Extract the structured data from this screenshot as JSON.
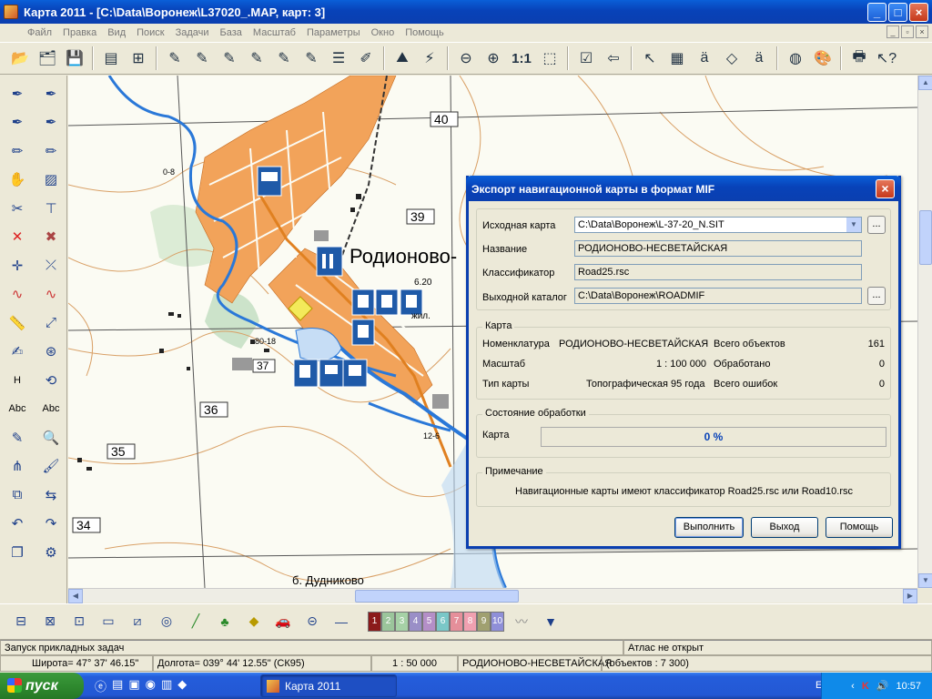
{
  "window": {
    "title": "Карта 2011 - [C:\\Data\\Воронеж\\L37020_.MAP, карт: 3]"
  },
  "menu": [
    "Файл",
    "Правка",
    "Вид",
    "Поиск",
    "Задачи",
    "База",
    "Масштаб",
    "Параметры",
    "Окно",
    "Помощь"
  ],
  "toolbar": {
    "scale_label": "1:1"
  },
  "lefttools": {
    "h_label": "H",
    "abc1": "Abc",
    "abc2": "Abc"
  },
  "map": {
    "place_main": "Родионово-",
    "place_south": "б. Дудниково",
    "place_zhil": "жил.",
    "grid_labels": [
      "40",
      "39",
      "37",
      "36",
      "35",
      "34"
    ],
    "small_labels": [
      "0-8",
      "6.20",
      "80-18",
      "12-6"
    ],
    "colors": {
      "urban": "#f2a35a",
      "water": "#2a78d8",
      "road": "#e08020",
      "contour": "#d9a066",
      "poi": "#1f5aa8",
      "vegetation": "#b8d9b8"
    }
  },
  "dialog": {
    "title": "Экспорт навигационной карты в формат MIF",
    "source_label": "Исходная карта",
    "source_value": "C:\\Data\\Воронеж\\L-37-20_N.SIT",
    "name_label": "Название",
    "name_value": "РОДИОНОВО-НЕСВЕТАЙСКАЯ",
    "classifier_label": "Классификатор",
    "classifier_value": "Road25.rsc",
    "outdir_label": "Выходной каталог",
    "outdir_value": "C:\\Data\\Воронеж\\ROADMIF",
    "browse": "...",
    "map_group": "Карта",
    "nomenclature_label": "Номенклатура",
    "nomenclature_value": "РОДИОНОВО-НЕСВЕТАЙСКАЯ",
    "total_label": "Всего объектов",
    "total_value": "161",
    "scale_label": "Масштаб",
    "scale_value": "1 : 100 000",
    "processed_label": "Обработано",
    "processed_value": "0",
    "type_label": "Тип карты",
    "type_value": "Топографическая 95 года",
    "errors_label": "Всего ошибок",
    "errors_value": "0",
    "state_group": "Состояние обработки",
    "state_map_label": "Карта",
    "progress_text": "0 %",
    "progress_value": 0,
    "note_group": "Примечание",
    "note_text": "Навигационные карты имеют классификатор Road25.rsc или Road10.rsc",
    "btn_run": "Выполнить",
    "btn_exit": "Выход",
    "btn_help": "Помощь"
  },
  "bottom": {
    "layers": [
      "1",
      "2",
      "3",
      "4",
      "5",
      "6",
      "7",
      "8",
      "9",
      "10"
    ],
    "layer_colors": [
      "#8b1a1a",
      "#9bc59b",
      "#a6d1a6",
      "#9a8fc7",
      "#b48fc7",
      "#7ac7c7",
      "#e58f9a",
      "#f0a0b0",
      "#a0a070",
      "#8f8fd8"
    ]
  },
  "status": {
    "tasks": "Запуск прикладных задач",
    "atlas": "Атлас не открыт",
    "lat": "Широта= 47° 37' 46.15\"",
    "lon": "Долгота= 039° 44' 12.55\"  (СК95)",
    "scale": "1 : 50 000",
    "map_name": "РОДИОНОВО-НЕСВЕТАЙСКАЯ",
    "objects": "(объектов : 7 300)"
  },
  "taskbar": {
    "start": "пуск",
    "task": "Карта 2011",
    "lang": "EN",
    "clock": "10:57"
  }
}
